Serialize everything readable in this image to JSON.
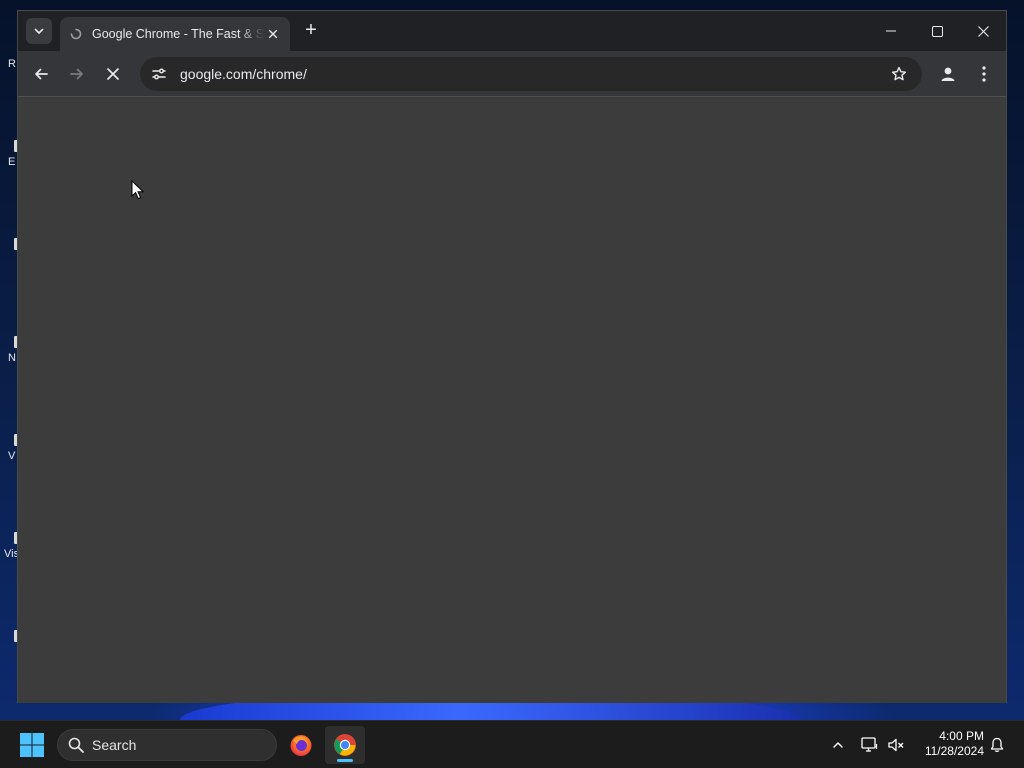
{
  "desktop": {
    "icons": [
      {
        "label": "R"
      },
      {
        "label": "E"
      },
      {
        "label": ""
      },
      {
        "label": "N"
      },
      {
        "label": "V"
      },
      {
        "label": "Vis"
      },
      {
        "label": ""
      }
    ]
  },
  "browser": {
    "tab_search_icon": "chevron-down-icon",
    "tab": {
      "title": "Google Chrome - The Fast & Secure Web Browser Built to be Yours",
      "favicon": "loading-favicon-icon",
      "close_icon": "close-icon"
    },
    "new_tab_label": "+",
    "window_controls": {
      "minimize": "minimize-icon",
      "maximize": "maximize-icon",
      "close": "close-icon"
    },
    "toolbar": {
      "back": "back-arrow-icon",
      "forward": "forward-arrow-icon",
      "stop": "stop-loading-icon",
      "site_info": "tune-icon",
      "url": "google.com/chrome/",
      "bookmark": "star-icon",
      "profile": "profile-icon",
      "menu": "kebab-menu-icon"
    },
    "page": {
      "state": "loading"
    }
  },
  "taskbar": {
    "start": "windows-start-icon",
    "search_placeholder": "Search",
    "apps": [
      {
        "name": "Firefox",
        "icon": "firefox-icon",
        "active": false
      },
      {
        "name": "Google Chrome",
        "icon": "chrome-icon",
        "active": true
      }
    ],
    "tray": {
      "chevron": "chevron-up-icon",
      "network": "network-icon",
      "volume": "volume-muted-icon",
      "notifications": "bell-icon"
    },
    "clock": {
      "time": "4:00 PM",
      "date": "11/28/2024"
    }
  },
  "colors": {
    "accent": "#4cc2ff",
    "chrome_frame": "#202124",
    "chrome_toolbar": "#35363a",
    "omnibox": "#282828",
    "page_bg": "#3c3c3c"
  }
}
